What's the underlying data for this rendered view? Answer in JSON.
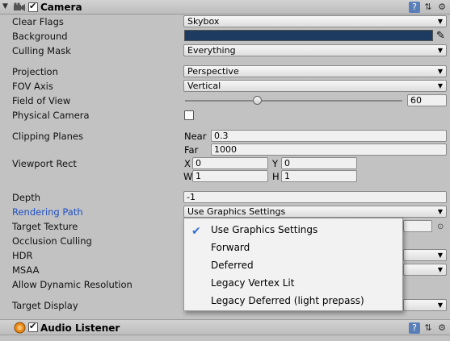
{
  "camera": {
    "title": "Camera",
    "fields": {
      "clear_flags": {
        "label": "Clear Flags",
        "value": "Skybox"
      },
      "background": {
        "label": "Background",
        "color": "#1d3a60"
      },
      "culling_mask": {
        "label": "Culling Mask",
        "value": "Everything"
      },
      "projection": {
        "label": "Projection",
        "value": "Perspective"
      },
      "fov_axis": {
        "label": "FOV Axis",
        "value": "Vertical"
      },
      "field_of_view": {
        "label": "Field of View",
        "value": "60",
        "slider_fraction": 0.33
      },
      "physical_camera": {
        "label": "Physical Camera"
      },
      "clipping_planes": {
        "label": "Clipping Planes",
        "near_label": "Near",
        "near": "0.3",
        "far_label": "Far",
        "far": "1000"
      },
      "viewport_rect": {
        "label": "Viewport Rect",
        "x_label": "X",
        "x": "0",
        "y_label": "Y",
        "y": "0",
        "w_label": "W",
        "w": "1",
        "h_label": "H",
        "h": "1"
      },
      "depth": {
        "label": "Depth",
        "value": "-1"
      },
      "rendering_path": {
        "label": "Rendering Path",
        "value": "Use Graphics Settings"
      },
      "target_texture": {
        "label": "Target Texture"
      },
      "occlusion_culling": {
        "label": "Occlusion Culling"
      },
      "hdr": {
        "label": "HDR"
      },
      "msaa": {
        "label": "MSAA"
      },
      "allow_dynamic_resolution": {
        "label": "Allow Dynamic Resolution"
      },
      "target_display": {
        "label": "Target Display"
      }
    }
  },
  "rendering_path_menu": {
    "items": [
      "Use Graphics Settings",
      "Forward",
      "Deferred",
      "Legacy Vertex Lit",
      "Legacy Deferred (light prepass)"
    ],
    "selected": "Use Graphics Settings"
  },
  "audio_listener": {
    "title": "Audio Listener"
  },
  "icons": [
    "camera-icon",
    "help-book-icon",
    "presets-icon",
    "gear-icon",
    "eyedropper-icon",
    "audio-listener-icon",
    "checkmark-icon"
  ]
}
